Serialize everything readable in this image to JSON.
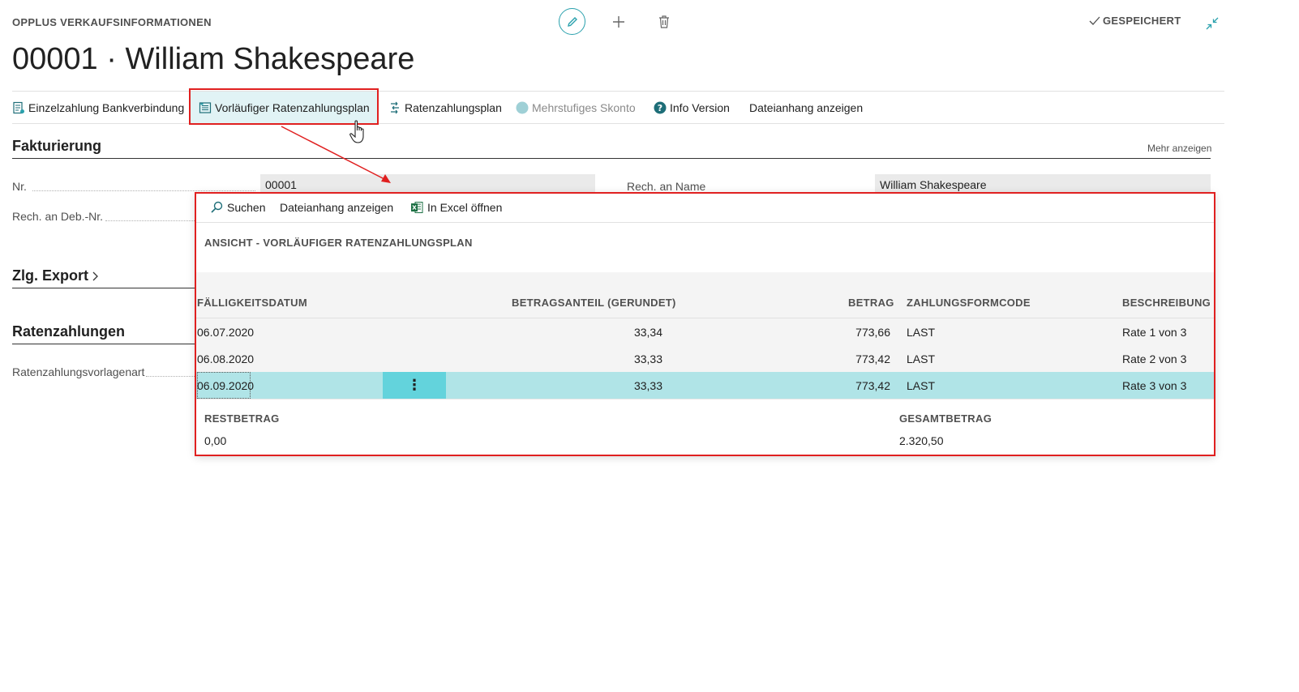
{
  "header": {
    "app_title": "OPPLUS VERKAUFSINFORMATIONEN",
    "saved_label": "GESPEICHERT",
    "page_title": "00001 · William Shakespeare"
  },
  "actions": [
    {
      "label": "Einzelzahlung Bankverbindung",
      "icon": "bank-payment-icon"
    },
    {
      "label": "Vorläufiger Ratenzahlungsplan",
      "icon": "plan-list-icon"
    },
    {
      "label": "Ratenzahlungsplan",
      "icon": "plan-arrow-icon"
    },
    {
      "label": "Mehrstufiges Skonto",
      "icon": "circle-icon"
    },
    {
      "label": "Info Version",
      "icon": "help-icon"
    },
    {
      "label": "Dateianhang anzeigen",
      "icon": ""
    }
  ],
  "sections": {
    "fakturierung": {
      "title": "Fakturierung",
      "more_label": "Mehr anzeigen",
      "nr_label": "Nr.",
      "nr_value": "00001",
      "rech_name_label": "Rech. an Name",
      "rech_name_value": "William Shakespeare",
      "rech_deb_label": "Rech. an Deb.-Nr."
    },
    "zlg_export": {
      "title": "Zlg. Export"
    },
    "ratenzahlungen": {
      "title": "Ratenzahlungen",
      "vorlagenart_label": "Ratenzahlungsvorlagenart"
    }
  },
  "modal": {
    "toolbar": {
      "search": "Suchen",
      "attachments": "Dateianhang anzeigen",
      "excel": "In Excel öffnen"
    },
    "subtitle": "ANSICHT - VORLÄUFIGER RATENZAHLUNGSPLAN",
    "columns": {
      "date": "FÄLLIGKEITSDATUM",
      "share": "BETRAGSANTEIL (GERUNDET)",
      "amount": "BETRAG",
      "code": "ZAHLUNGSFORMCODE",
      "desc": "BESCHREIBUNG"
    },
    "rows": [
      {
        "date": "06.07.2020",
        "share": "33,34",
        "amount": "773,66",
        "code": "LAST",
        "desc": "Rate 1 von 3"
      },
      {
        "date": "06.08.2020",
        "share": "33,33",
        "amount": "773,42",
        "code": "LAST",
        "desc": "Rate 2 von 3"
      },
      {
        "date": "06.09.2020",
        "share": "33,33",
        "amount": "773,42",
        "code": "LAST",
        "desc": "Rate 3 von 3"
      }
    ],
    "selected_row": 3,
    "row_menu_glyph": "⋮",
    "restbetrag_label": "RESTBETRAG",
    "restbetrag_value": "0,00",
    "gesamtbetrag_label": "GESAMTBETRAG",
    "gesamtbetrag_value": "2.320,50"
  },
  "colors": {
    "accent": "#2aa1ad",
    "selected_row": "#b0e4e7",
    "row_menu": "#63d3dc",
    "highlight_box": "#e02020",
    "excel_green": "#1e7145"
  }
}
